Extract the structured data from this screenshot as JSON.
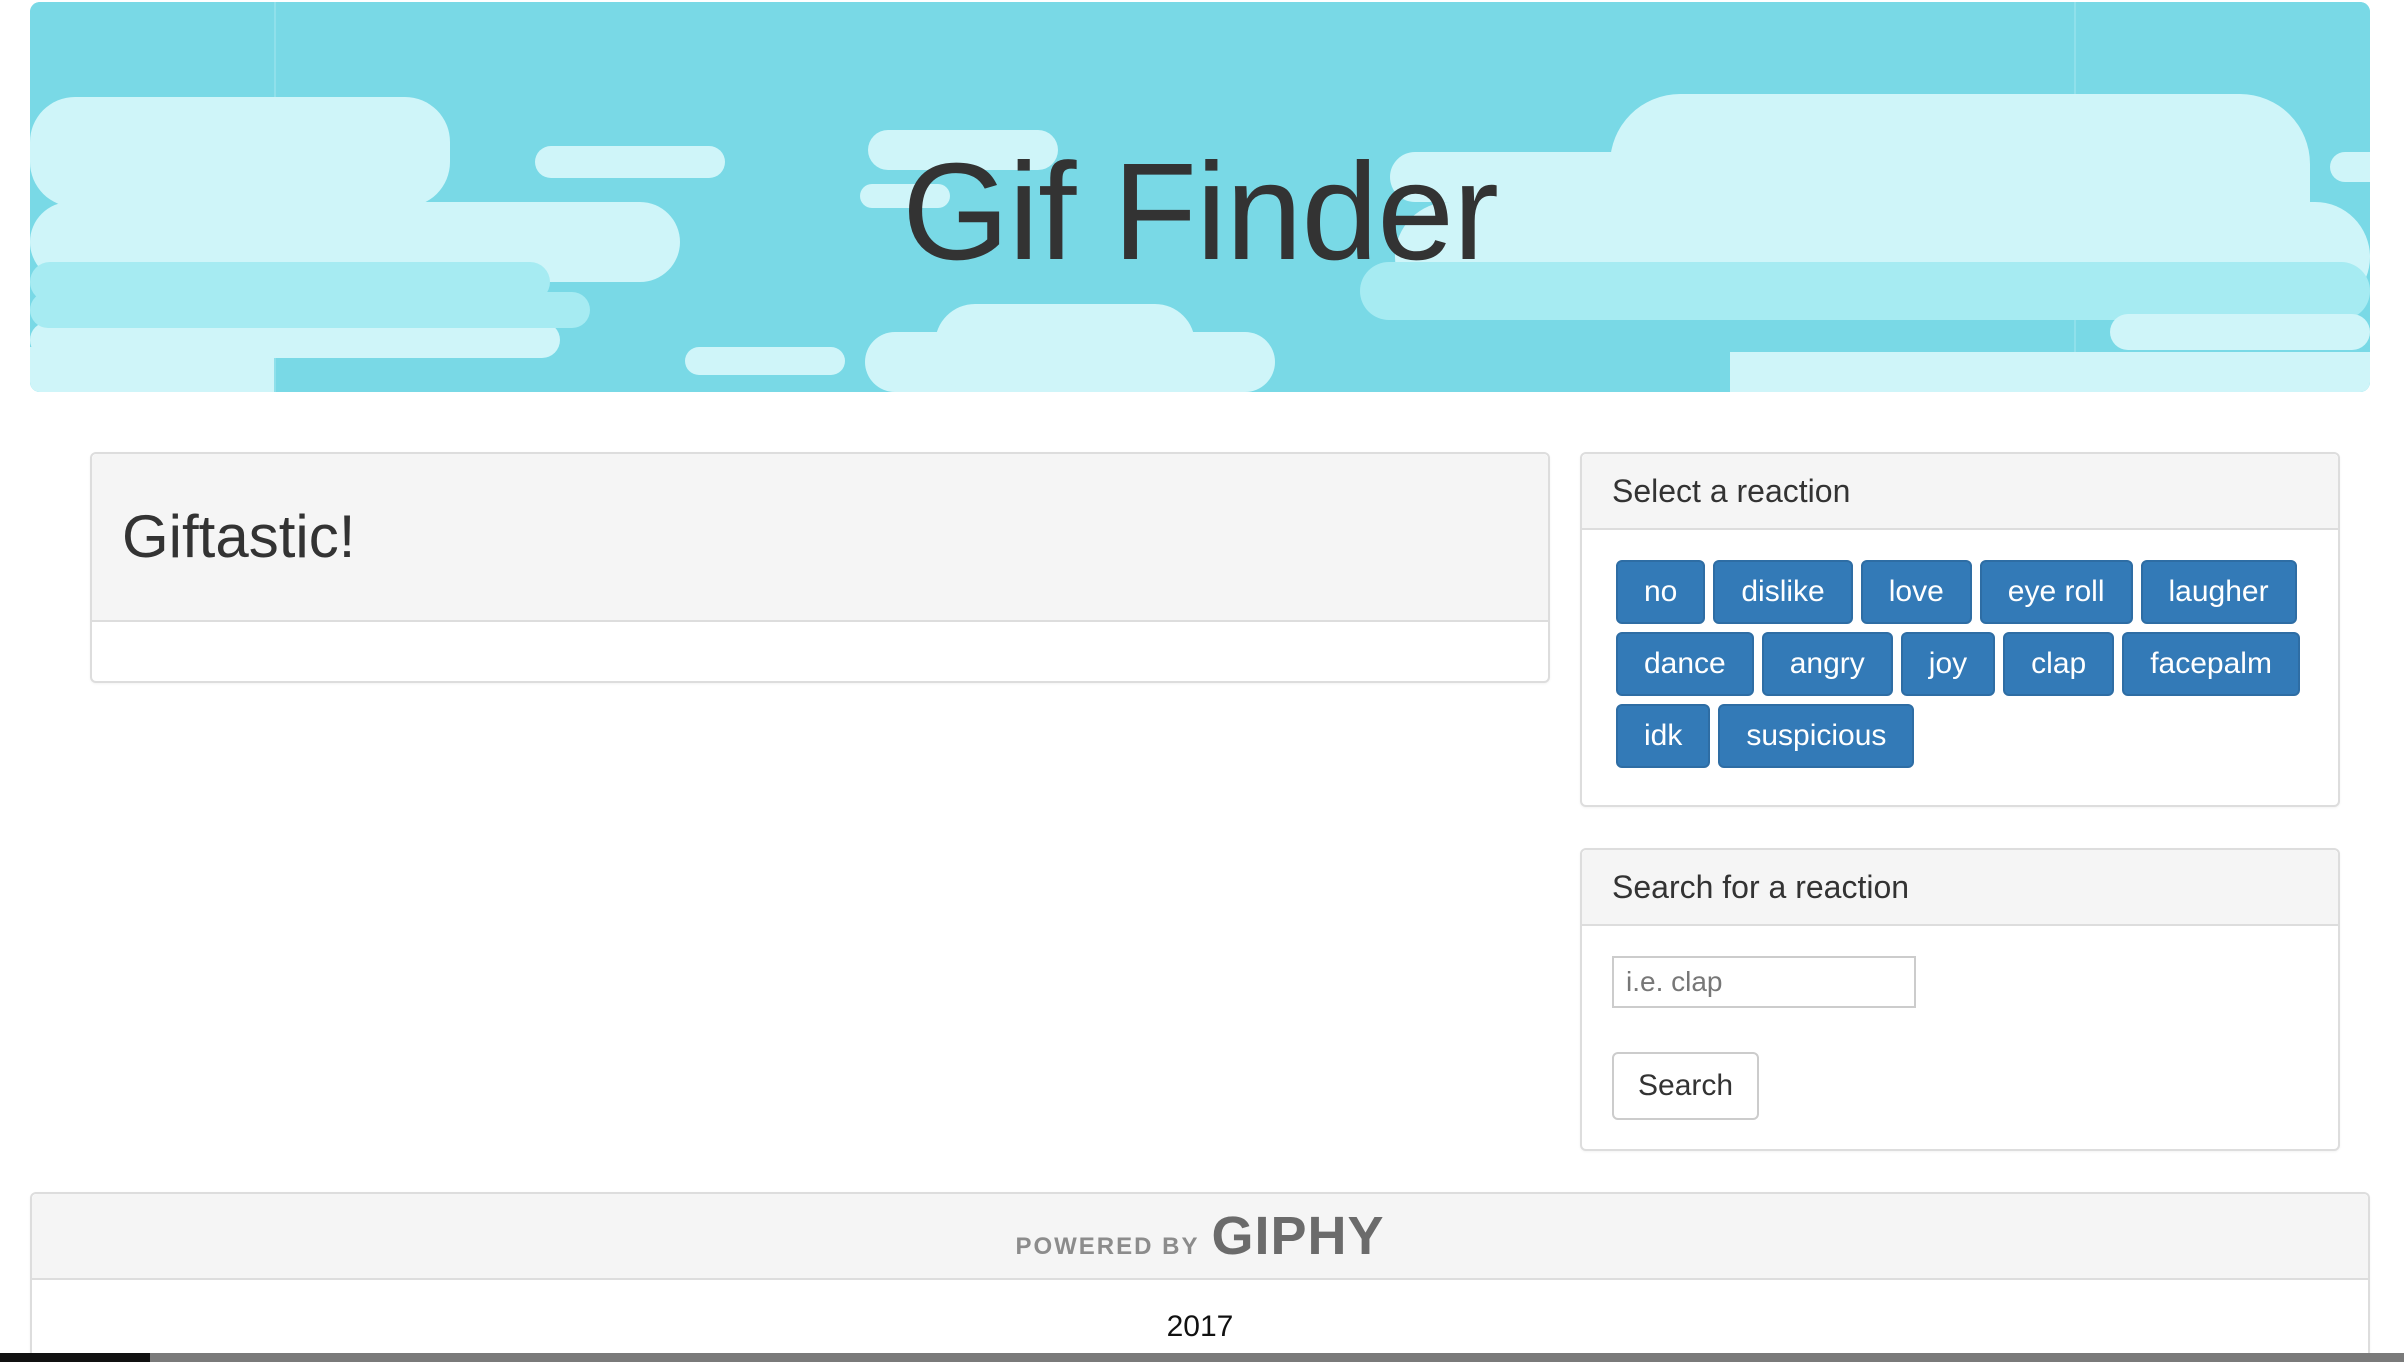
{
  "header": {
    "title": "Gif Finder"
  },
  "main": {
    "heading": "Giftastic!"
  },
  "reactions": {
    "heading": "Select a reaction",
    "buttons": [
      "no",
      "dislike",
      "love",
      "eye roll",
      "laugher",
      "dance",
      "angry",
      "joy",
      "clap",
      "facepalm",
      "idk",
      "suspicious"
    ]
  },
  "search": {
    "heading": "Search for a reaction",
    "placeholder": "i.e. clap",
    "value": "",
    "button_label": "Search"
  },
  "footer": {
    "powered_by": "POWERED BY",
    "brand": "GIPHY",
    "year": "2017"
  },
  "colors": {
    "sky": "#79d9e6",
    "cloud": "#cff5f9",
    "primary_button": "#337ab7",
    "panel_heading_bg": "#f5f5f5"
  },
  "icons": {
    "banner": "cloud-illustration",
    "footer_logo": "giphy-logo"
  }
}
